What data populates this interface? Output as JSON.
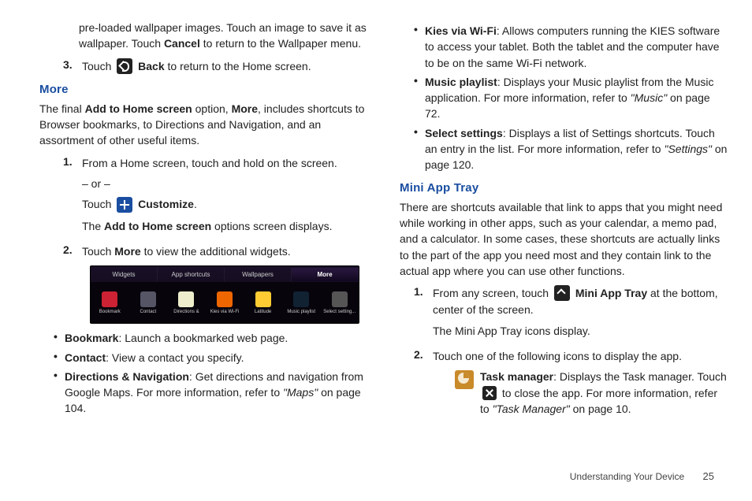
{
  "leftcol": {
    "intro1": "pre-loaded wallpaper images. Touch an image to save it as wallpaper. Touch ",
    "intro1b": "Cancel",
    "intro1c": " to return to the Wallpaper menu.",
    "step3num": "3.",
    "step3a": "Touch ",
    "step3b": "Back",
    "step3c": " to return to the Home screen.",
    "moreHeading": "More",
    "morepara_a": "The final ",
    "morepara_b": "Add to Home screen",
    "morepara_c": " option, ",
    "morepara_d": "More",
    "morepara_e": ", includes shortcuts to Browser bookmarks, to Directions and Navigation, and an assortment of other useful items.",
    "ms1num": "1.",
    "ms1a": "From a Home screen, touch and hold on the screen.",
    "ms1or": "– or –",
    "ms1b_a": "Touch ",
    "ms1b_b": "Customize",
    "ms1b_c": ".",
    "ms1c_a": "The ",
    "ms1c_b": "Add to Home screen",
    "ms1c_c": " options screen displays.",
    "ms2num": "2.",
    "ms2_a": "Touch ",
    "ms2_b": "More",
    "ms2_c": " to view the additional widgets.",
    "tabs": {
      "t1": "Widgets",
      "t2": "App shortcuts",
      "t3": "Wallpapers",
      "t4": "More",
      "a1": "Bookmark",
      "a2": "Contact",
      "a3": "Directions &",
      "a4": "Kies via Wi-Fi",
      "a5": "Latitude",
      "a6": "Music playlist",
      "a7": "Select setting..."
    },
    "b1a": "Bookmark",
    "b1b": ": Launch a bookmarked web page.",
    "b2a": "Contact",
    "b2b": ": View a contact you specify.",
    "b3a": "Directions & Navigation",
    "b3b": ": Get directions and navigation from Google Maps. For more information, refer to ",
    "b3ref": "\"Maps\"",
    "b3c": " on page 104."
  },
  "rightcol": {
    "rb1a": "Kies via Wi-Fi",
    "rb1b": ": Allows computers running the KIES software to access your tablet. Both the tablet and the computer have to be on the same Wi-Fi network.",
    "rb2a": "Music playlist",
    "rb2b": ": Displays your Music playlist from the Music application. For more information, refer to ",
    "rb2ref": "\"Music\"",
    "rb2c": " on page 72.",
    "rb3a": "Select settings",
    "rb3b": ": Displays a list of Settings shortcuts. Touch an entry in the list. For more information, refer to ",
    "rb3ref": "\"Settings\"",
    "rb3c": " on page 120.",
    "miniHeading": "Mini App Tray",
    "minipara": "There are shortcuts available that link to apps that you might need while working in other apps, such as your calendar, a memo pad, and a calculator. In some cases, these shortcuts are actually links to the part of the app you need most and they contain link to the actual app where you can use other functions.",
    "min1num": "1.",
    "min1a": "From any screen, touch ",
    "min1b": "Mini App Tray",
    "min1c": " at the bottom, center of the screen.",
    "min1d": "The Mini App Tray icons display.",
    "min2num": "2.",
    "min2a": "Touch one of the following icons to display the app.",
    "task_a": "Task manager",
    "task_b": ": Displays the Task manager. Touch ",
    "task_c": " to close the app. For more information, refer to ",
    "task_ref": "\"Task Manager\"",
    "task_d": " on page 10."
  },
  "footer": {
    "section": "Understanding Your Device",
    "page": "25"
  }
}
